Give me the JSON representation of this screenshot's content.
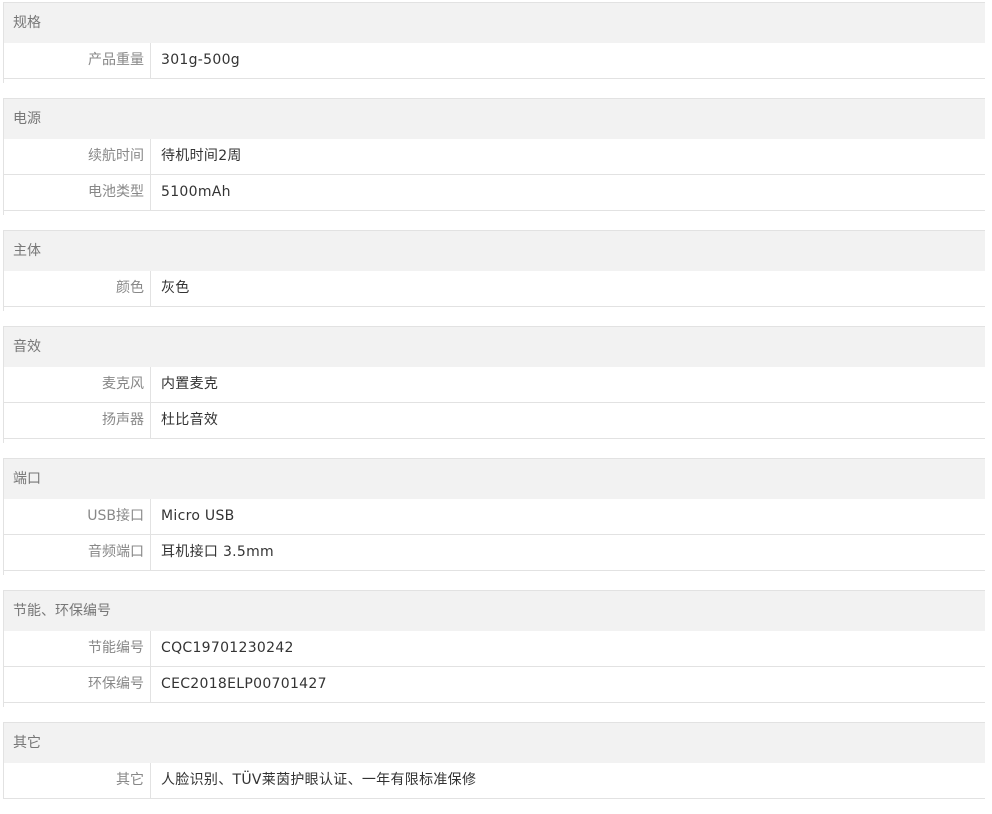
{
  "sections": [
    {
      "title": "规格",
      "rows": [
        {
          "label": "产品重量",
          "value": "301g-500g"
        }
      ]
    },
    {
      "title": "电源",
      "rows": [
        {
          "label": "续航时间",
          "value": "待机时间2周"
        },
        {
          "label": "电池类型",
          "value": "5100mAh"
        }
      ]
    },
    {
      "title": "主体",
      "rows": [
        {
          "label": "颜色",
          "value": "灰色"
        }
      ]
    },
    {
      "title": "音效",
      "rows": [
        {
          "label": "麦克风",
          "value": "内置麦克"
        },
        {
          "label": "扬声器",
          "value": "杜比音效"
        }
      ]
    },
    {
      "title": "端口",
      "rows": [
        {
          "label": "USB接口",
          "value": "Micro USB"
        },
        {
          "label": "音频端口",
          "value": "耳机接口 3.5mm"
        }
      ]
    },
    {
      "title": "节能、环保编号",
      "rows": [
        {
          "label": "节能编号",
          "value": "CQC19701230242"
        },
        {
          "label": "环保编号",
          "value": "CEC2018ELP00701427"
        }
      ]
    },
    {
      "title": "其它",
      "rows": [
        {
          "label": "其它",
          "value": "人脸识别、TÜV莱茵护眼认证、一年有限标准保修"
        }
      ]
    }
  ]
}
